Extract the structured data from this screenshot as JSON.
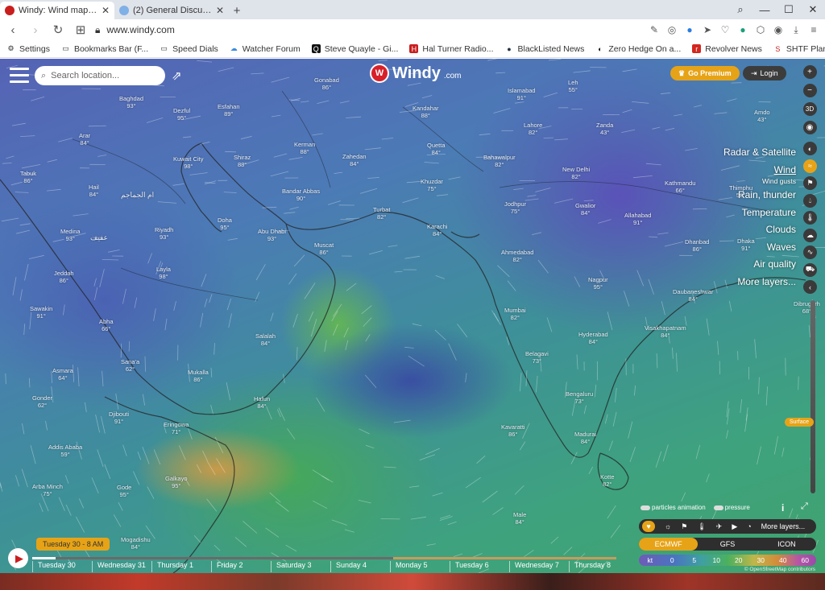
{
  "browser": {
    "tabs": [
      {
        "title": "Windy: Wind map & wea",
        "active": true,
        "close": "✕"
      },
      {
        "title": "(2) General Discussion",
        "active": false,
        "close": "✕"
      }
    ],
    "new_tab": "+",
    "url": "www.windy.com",
    "bookmarks": [
      {
        "label": "Settings",
        "icon": "gear-icon"
      },
      {
        "label": "Bookmarks Bar (F...",
        "icon": "folder-icon"
      },
      {
        "label": "Speed Dials",
        "icon": "folder-icon"
      },
      {
        "label": "Watcher Forum",
        "icon": "cloud-icon"
      },
      {
        "label": "Steve Quayle - Gi...",
        "icon": "q-icon"
      },
      {
        "label": "Hal Turner Radio...",
        "icon": "hal-icon"
      },
      {
        "label": "BlackListed News",
        "icon": "globe-icon"
      },
      {
        "label": "Zero Hedge  On a...",
        "icon": "zh-icon"
      },
      {
        "label": "Revolver News",
        "icon": "r-icon"
      },
      {
        "label": "SHTF Plan - Whe...",
        "icon": "s-icon"
      }
    ]
  },
  "windy": {
    "search_placeholder": "Search location...",
    "logo": "Windy",
    "logo_suffix": ".com",
    "premium": "Go Premium",
    "login": "Login",
    "zoom_in": "+",
    "zoom_out": "−",
    "mode_3d": "3D",
    "layers": [
      {
        "label": "Radar & Satellite",
        "selected": false
      },
      {
        "label": "Wind",
        "selected": true
      },
      {
        "label": "Wind gusts",
        "selected": false,
        "small": true
      },
      {
        "label": "Rain, thunder",
        "selected": false
      },
      {
        "label": "Temperature",
        "selected": false
      },
      {
        "label": "Clouds",
        "selected": false
      },
      {
        "label": "Waves",
        "selected": false
      },
      {
        "label": "Air quality",
        "selected": false
      },
      {
        "label": "More layers...",
        "selected": false
      }
    ],
    "surface": "Surface",
    "particles": "particles animation",
    "pressure": "pressure",
    "more_layers": "More layers...",
    "models": [
      {
        "label": "ECMWF",
        "selected": true
      },
      {
        "label": "GFS",
        "selected": false
      },
      {
        "label": "ICON",
        "selected": false
      }
    ],
    "legend": {
      "unit": "kt",
      "values": [
        "0",
        "5",
        "10",
        "20",
        "30",
        "40",
        "60"
      ]
    },
    "osm": "© OpenStreetMap contributors",
    "time_badge": "Tuesday 30 - 8 AM",
    "timeline_progress": 0.04,
    "days": [
      "Tuesday 30",
      "Wednesday 31",
      "Thursday 1",
      "Friday 2",
      "Saturday 3",
      "Sunday 4",
      "Monday 5",
      "Tuesday 6",
      "Wednesday 7",
      "Thursday 8"
    ],
    "cities": [
      {
        "name": "Baghdad",
        "t": "93°"
      },
      {
        "name": "Dezful",
        "t": "95°"
      },
      {
        "name": "Esfahan",
        "t": "89°"
      },
      {
        "name": "Gonabad",
        "t": "86°"
      },
      {
        "name": "Kerman",
        "t": "88°"
      },
      {
        "name": "Zahedan",
        "t": "84°"
      },
      {
        "name": "Kandahar",
        "t": "88°"
      },
      {
        "name": "Quetta",
        "t": "84°"
      },
      {
        "name": "Islamabad",
        "t": "91°"
      },
      {
        "name": "Lahore",
        "t": "82°"
      },
      {
        "name": "Leh",
        "t": "55°"
      },
      {
        "name": "Zanda",
        "t": "43°"
      },
      {
        "name": "Kuwait City",
        "t": "98°"
      },
      {
        "name": "Shiraz",
        "t": "88°"
      },
      {
        "name": "Arar",
        "t": "84°"
      },
      {
        "name": "Tabuk",
        "t": "86°"
      },
      {
        "name": "Hail",
        "t": "84°"
      },
      {
        "name": "Bandar Abbas",
        "t": "90°"
      },
      {
        "name": "Khuzdar",
        "t": "75°"
      },
      {
        "name": "Bahawalpur",
        "t": "82°"
      },
      {
        "name": "New Delhi",
        "t": "82°"
      },
      {
        "name": "Kathmandu",
        "t": "66°"
      },
      {
        "name": "Thimphu",
        "t": "52°"
      },
      {
        "name": "Doha",
        "t": "95°"
      },
      {
        "name": "Abu Dhabi",
        "t": "93°"
      },
      {
        "name": "Turbat",
        "t": "82°"
      },
      {
        "name": "Karachi",
        "t": "84°"
      },
      {
        "name": "Jodhpur",
        "t": "75°"
      },
      {
        "name": "Gwalior",
        "t": "84°"
      },
      {
        "name": "Allahabad",
        "t": "91°"
      },
      {
        "name": "Medina",
        "t": "93°"
      },
      {
        "name": "Riyadh",
        "t": "93°"
      },
      {
        "name": "Muscat",
        "t": "86°"
      },
      {
        "name": "Ahmedabad",
        "t": "82°"
      },
      {
        "name": "Dhanbad",
        "t": "86°"
      },
      {
        "name": "Dhaka",
        "t": "91°"
      },
      {
        "name": "Jeddah",
        "t": "86°"
      },
      {
        "name": "Layla",
        "t": "98°"
      },
      {
        "name": "Nagpur",
        "t": "95°"
      },
      {
        "name": "Sawakin",
        "t": "91°"
      },
      {
        "name": "Abha",
        "t": "66°"
      },
      {
        "name": "Mumbai",
        "t": "82°"
      },
      {
        "name": "Salalah",
        "t": "84°"
      },
      {
        "name": "Visakhapatnam",
        "t": "84°"
      },
      {
        "name": "Hyderabad",
        "t": "84°"
      },
      {
        "name": "Asmara",
        "t": "64°"
      },
      {
        "name": "Sana'a",
        "t": "62°"
      },
      {
        "name": "Mukalla",
        "t": "86°"
      },
      {
        "name": "Belagavi",
        "t": "73°"
      },
      {
        "name": "Gonder",
        "t": "62°"
      },
      {
        "name": "Hafun",
        "t": "84°"
      },
      {
        "name": "Bengaluru",
        "t": "73°"
      },
      {
        "name": "Djibouti",
        "t": "91°"
      },
      {
        "name": "Eringowa",
        "t": "71°"
      },
      {
        "name": "Kavaratti",
        "t": "86°"
      },
      {
        "name": "Madurai",
        "t": "84°"
      },
      {
        "name": "Addis Ababa",
        "t": "59°"
      },
      {
        "name": "Galkayo",
        "t": "95°"
      },
      {
        "name": "Kotte",
        "t": "82°"
      },
      {
        "name": "Arba Minch",
        "t": "75°"
      },
      {
        "name": "Gode",
        "t": "95°"
      },
      {
        "name": "Male",
        "t": "84°"
      },
      {
        "name": "Mogadishu",
        "t": "84°"
      },
      {
        "name": "Dibrugarh",
        "t": "68°"
      },
      {
        "name": "Daubaneshwar",
        "t": "84°"
      },
      {
        "name": "Amdo",
        "t": "43°"
      }
    ],
    "arabic_labels": [
      "ام الجماجم",
      "عفيف"
    ]
  }
}
